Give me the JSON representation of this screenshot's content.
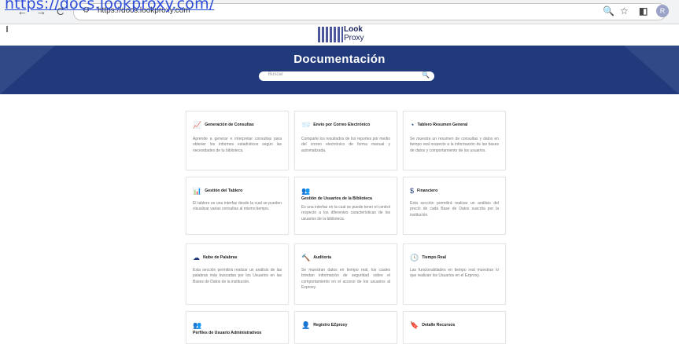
{
  "overlay_url": "https://docs.lookproxy.com/",
  "browser": {
    "address": "https://docs.lookproxy.com",
    "avatar_letter": "R"
  },
  "logo": {
    "line1": "Look",
    "line2": "Proxy"
  },
  "banner": {
    "title": "Documentación",
    "search_placeholder": "Buscar",
    "color": "#203a7c"
  },
  "cards": [
    {
      "icon": "chart-icon",
      "title": "Generación de Consultas",
      "desc": "Aprende a generar e interpretar consultas para obtener los informes estadísticos según las necesidades de tu biblioteca."
    },
    {
      "icon": "mail-send-icon",
      "title": "Envío por Correo Electrónico",
      "desc": "Comparte los resultados de los reportes por medio del correo electrónico de forma manual y automatizada."
    },
    {
      "icon": "dashboard-icon",
      "title": "Tablero Resumen General",
      "desc": "Se muestra un resumen de consultas y datos en tiempo real respecto a la información de las bases de datos y comportamiento de los usuarios."
    },
    {
      "icon": "bar-chart-icon",
      "title": "Gestión del Tablero",
      "desc": "El tablero es una interfaz desde la cual se pueden visualizar varias consultas al mismo tiempo."
    },
    {
      "icon": "users-manage-icon",
      "title": "Gestión de Usuarios de la Biblioteca",
      "desc": "Es una interfaz en la cual se puede tener el control respecto a los diferentes características de los usuarios de la biblioteca."
    },
    {
      "icon": "dollar-icon",
      "title": "Financiero",
      "desc": "Esta sección permitirá realizar un análisis del precio de cada Base de Datos suscrita por la institución."
    },
    {
      "icon": "cloud-icon",
      "title": "Nube de Palabras",
      "desc": "Esta sección permitirá realizar un análisis de las palabras más buscadas por los Usuarios en las Bases de Datos de la institución."
    },
    {
      "icon": "gavel-icon",
      "title": "Auditoría",
      "desc": "Se muestran datos en tiempo real, los cuales brindan información de seguridad sobre el comportamiento en el acceso de los usuarios al Ezproxy."
    },
    {
      "icon": "clock-icon",
      "title": "Tiempo Real",
      "desc": "Las funcionalidades en tiempo real muestran lo que realizan los Usuarios en el Ezproxy."
    },
    {
      "icon": "admin-users-icon",
      "title": "Perfiles de Usuario Administrativos",
      "desc": ""
    },
    {
      "icon": "user-add-icon",
      "title": "Registro EZproxy",
      "desc": ""
    },
    {
      "icon": "bookmark-icon",
      "title": "Detalle Recursos",
      "desc": ""
    }
  ]
}
